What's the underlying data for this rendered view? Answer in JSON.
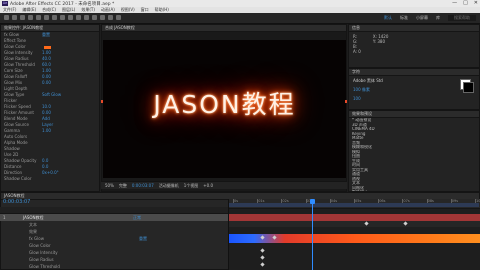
{
  "app": {
    "title": "Adobe After Effects CC 2017 - 未命名项目.aep *",
    "logo_text": "Ae"
  },
  "window_controls": [
    "—",
    "□",
    "✕"
  ],
  "menu": [
    "文件(F)",
    "编辑(E)",
    "合成(C)",
    "图层(L)",
    "效果(T)",
    "动画(A)",
    "视图(V)",
    "窗口",
    "帮助(H)"
  ],
  "toolbar": {
    "workspace": [
      "默认",
      "标准",
      "小屏幕",
      "库"
    ],
    "search_placeholder": "搜索帮助"
  },
  "left_panel": {
    "tab": "效果控件: JASON教程",
    "rows": [
      {
        "name": "fx Glow",
        "value": "重置"
      },
      {
        "name": "Effect Tone",
        "value": ""
      },
      {
        "name": "Glow Color",
        "value": "",
        "swatch": "#ff6a1a"
      },
      {
        "name": "Glow Intensity",
        "value": "1.00"
      },
      {
        "name": "Glow Radius",
        "value": "40.0"
      },
      {
        "name": "Glow Threshold",
        "value": "60.0"
      },
      {
        "name": "Core Size",
        "value": "1.00"
      },
      {
        "name": "Glow Falloff",
        "value": "0.00"
      },
      {
        "name": "Glow Mix",
        "value": "0.00"
      },
      {
        "name": "Light Depth",
        "value": ""
      },
      {
        "name": "Glow Type",
        "value": "Soft Glow"
      },
      {
        "name": "Flicker",
        "value": ""
      },
      {
        "name": "Flicker Speed",
        "value": "10.0"
      },
      {
        "name": "Flicker Amount",
        "value": "0.00"
      },
      {
        "name": "Blend Mode",
        "value": "Add"
      },
      {
        "name": "Glow Source",
        "value": "Layer"
      },
      {
        "name": "Gamma",
        "value": "1.00"
      },
      {
        "name": "Auto Colors",
        "value": ""
      },
      {
        "name": "Alpha Mode",
        "value": ""
      },
      {
        "name": "Shadow",
        "value": ""
      },
      {
        "name": "Use 2D",
        "value": ""
      },
      {
        "name": "Shadow Opacity",
        "value": "0.0"
      },
      {
        "name": "Distance",
        "value": "0.0"
      },
      {
        "name": "Direction",
        "value": "0x+0.0°"
      },
      {
        "name": "Shadow Color",
        "value": ""
      }
    ]
  },
  "comp_panel": {
    "tab": "合成 JASON教程",
    "canvas_text": "JASON教程",
    "bottom_bar": [
      "50%",
      "完整",
      "0:00:03:07",
      "活动摄像机",
      "1个视图",
      "+0.0"
    ]
  },
  "right_panel": {
    "info_tab": "信息",
    "info_rows": [
      "R:",
      "G:",
      "B:",
      "A: 0",
      "X: 1420",
      "Y: 380"
    ],
    "char_tab": "字符",
    "font": "Adobe 黑体 Std",
    "font_size": "100 像素",
    "tracking": "100",
    "effects_tab": "效果和预设",
    "effects_rows": [
      "* 动画预设",
      "3D 声道",
      "CINEMA 4D",
      "Keying",
      "Matte",
      "音频",
      "模糊和锐化",
      "模拟",
      "扭曲",
      "生成",
      "时间",
      "实用工具",
      "通道",
      "透视",
      "文本",
      "风格化",
      "颜色校正"
    ]
  },
  "timeline": {
    "tab": "JASON教程",
    "timecode": "0:00:03:07",
    "layers": [
      {
        "num": "1",
        "name": "JASON教程",
        "mode": "正常"
      },
      {
        "num": "",
        "name": "文本",
        "mode": ""
      },
      {
        "num": "",
        "name": "效果",
        "mode": ""
      },
      {
        "num": "",
        "name": "fx Glow",
        "mode": "重置"
      },
      {
        "num": "",
        "name": "Glow Color",
        "mode": ""
      },
      {
        "num": "",
        "name": "Glow Intensity",
        "mode": ""
      },
      {
        "num": "",
        "name": "Glow Radius",
        "mode": ""
      },
      {
        "num": "",
        "name": "Glow Threshold",
        "mode": ""
      }
    ],
    "ruler_labels": [
      "0s",
      "01s",
      "02s",
      "03s",
      "04s",
      "05s",
      "06s",
      "07s",
      "08s",
      "09s",
      "10s"
    ],
    "playhead_fraction": 0.33
  }
}
